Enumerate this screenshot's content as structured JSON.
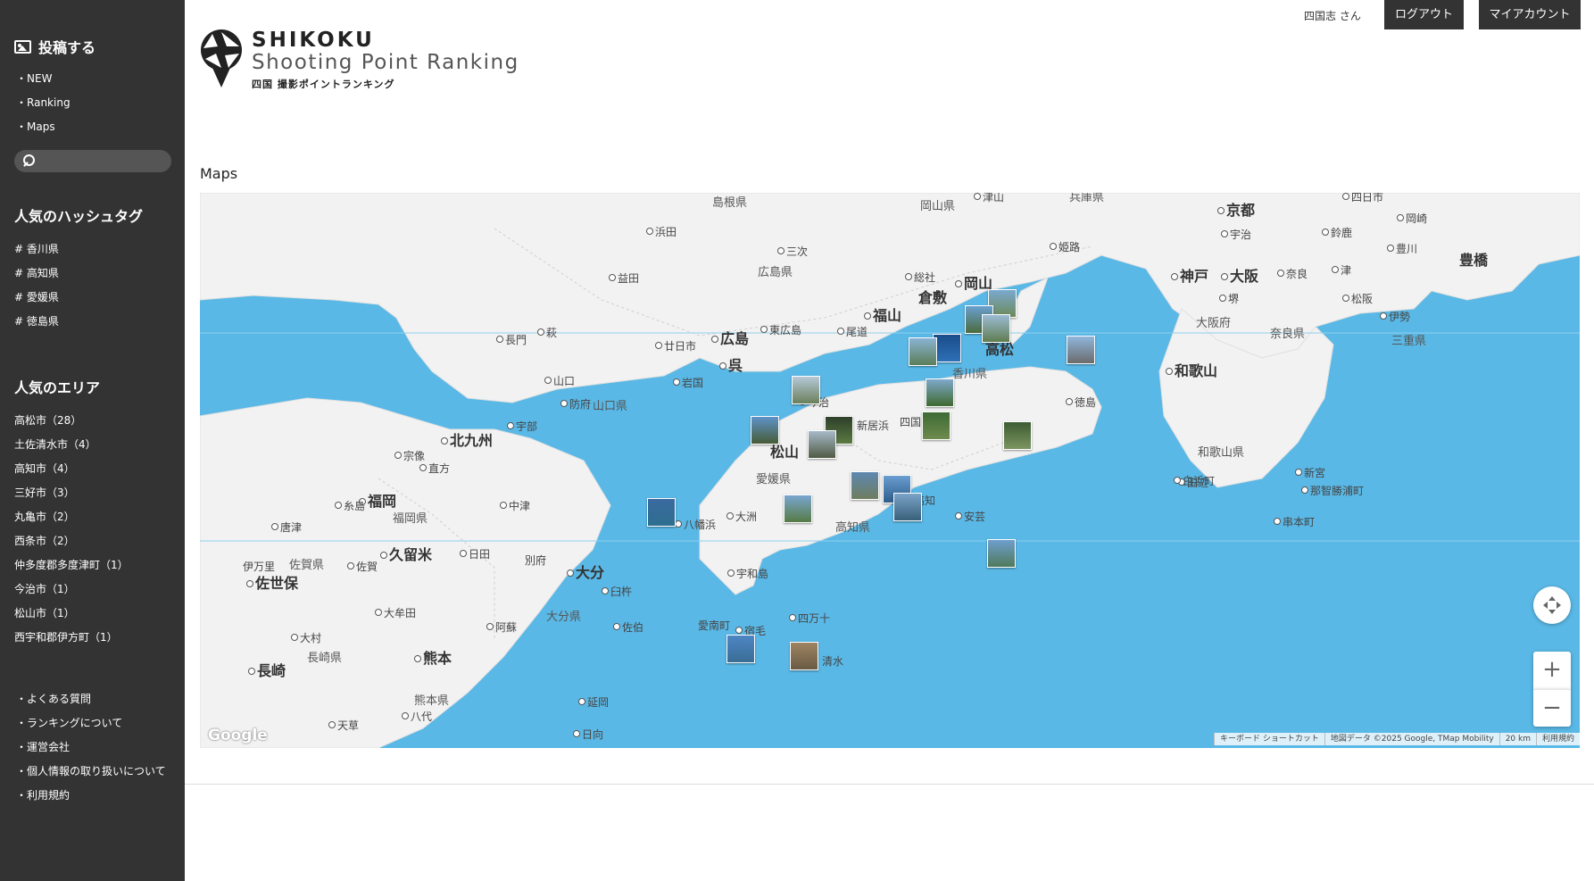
{
  "sidebar": {
    "post_label": "投稿する",
    "nav": [
      "NEW",
      "Ranking",
      "Maps"
    ],
    "search_placeholder": "",
    "hashtag_title": "人気のハッシュタグ",
    "hashtags": [
      "# 香川県",
      "# 高知県",
      "# 愛媛県",
      "# 徳島県"
    ],
    "area_title": "人気のエリア",
    "areas": [
      "高松市（28）",
      "土佐清水市（4）",
      "高知市（4）",
      "三好市（3）",
      "丸亀市（2）",
      "西条市（2）",
      "仲多度郡多度津町（1）",
      "今治市（1）",
      "松山市（1）",
      "西宇和郡伊方町（1）"
    ],
    "footer_links": [
      "よくある質問",
      "ランキングについて",
      "運営会社",
      "個人情報の取り扱いについて",
      "利用規約"
    ]
  },
  "header": {
    "logo_line1": "SHIKOKU",
    "logo_line2": "Shooting Point Ranking",
    "logo_line3": "四国 撮影ポイントランキング",
    "user": "四国志 さん",
    "logout": "ログアウト",
    "account": "マイアカウント"
  },
  "page_title": "Maps",
  "map": {
    "labels": {
      "shimane": "島根県",
      "okayama_ken": "岡山県",
      "tsuyama": "津山",
      "kyoto": "京都",
      "hyogo": "兵庫県",
      "hamada": "浜田",
      "miyoshi_h": "三次",
      "himeji": "姫路",
      "uji": "宇治",
      "shiga": "四日市",
      "okazaki": "岡崎",
      "suzuka": "鈴鹿",
      "hiroshima_ken": "広島県",
      "masuda": "益田",
      "soja": "総社",
      "okayama": "岡山",
      "kobe": "神戸",
      "osaka": "大阪",
      "nara": "奈良",
      "toyokawa": "豊川",
      "toyohashi": "豊橋",
      "tsu": "津",
      "kurashiki": "倉敷",
      "sakai": "堺",
      "matsusaka": "松阪",
      "ise": "伊勢",
      "fukuyama": "福山",
      "osaka_fu": "大阪府",
      "nara_ken": "奈良県",
      "nagato": "長門",
      "hagi": "萩",
      "hatsukaichi": "廿日市",
      "hiroshima": "広島",
      "higashihiroshima": "東広島",
      "onomichi": "尾道",
      "takamatsu": "高松",
      "mie": "三重県",
      "kure": "呉",
      "wakayama": "和歌山",
      "yamaguchi": "山口",
      "iwakuni": "岩国",
      "kagawa": "香川県",
      "hofu": "防府",
      "yamaguchi_ken": "山口県",
      "imabari": "今治",
      "tokushima": "徳島",
      "ube": "宇部",
      "niihama": "新居浜",
      "shikokuchuo": "四国中央",
      "kitakyushu": "北九州",
      "matsuyama": "松山",
      "munakata": "宗像",
      "nogata": "直方",
      "wakayama_ken": "和歌山県",
      "ehime": "愛媛県",
      "tanabe": "田辺",
      "fukuoka": "福岡",
      "itoshima": "糸島",
      "nakatsu": "中津",
      "shingu": "新宮",
      "shirahama": "白浜町",
      "nachikatsuura": "那智勝浦町",
      "fukuoka_ken": "福岡県",
      "ozu": "大洲",
      "yawatahama": "八幡浜",
      "kochi": "高知",
      "kochi_ken": "高知県",
      "aki": "安芸",
      "kushimoto": "串本町",
      "karatsu": "唐津",
      "kurume": "久留米",
      "hita": "日田",
      "beppu": "別府",
      "oita": "大分",
      "imari": "伊万里",
      "saga_ken": "佐賀県",
      "saga": "佐賀",
      "usuki": "臼杵",
      "sasebo": "佐世保",
      "uwajima": "宇和島",
      "omuta": "大牟田",
      "oita_ken": "大分県",
      "shimanto": "四万十",
      "aso": "阿蘇",
      "saiki": "佐伯",
      "omura": "大村",
      "ainan": "愛南町",
      "sukumo": "宿毛",
      "nagasaki_ken": "長崎県",
      "kumamoto": "熊本",
      "tosashimizu": "清水",
      "nagasaki": "長崎",
      "kumamoto_ken": "熊本県",
      "nobeoka": "延岡",
      "yatsushiro": "八代",
      "amakusa": "天草",
      "hyuga": "日向"
    },
    "attribution": {
      "google": "Google",
      "shortcuts": "キーボード ショートカット",
      "data": "地図データ ©2025 Google, TMap Mobility",
      "scale": "20 km",
      "terms": "利用規約"
    },
    "colors": {
      "sea": "#5ab8e6",
      "land": "#f2f2f2"
    }
  }
}
